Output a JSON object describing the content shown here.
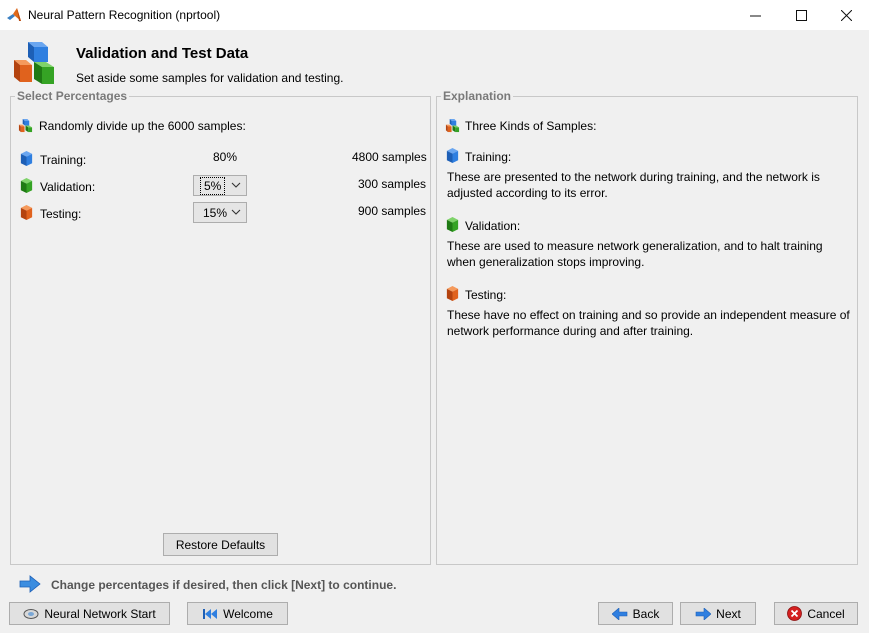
{
  "window": {
    "title": "Neural Pattern Recognition (nprtool)",
    "controls": {
      "minimize": "—",
      "maximize": "☐",
      "close": "✕"
    }
  },
  "header": {
    "title": "Validation and Test Data",
    "subtitle": "Set aside some samples for validation and testing."
  },
  "left_panel": {
    "label": "Select Percentages",
    "intro": "Randomly divide up the 6000 samples:",
    "rows": [
      {
        "label": "Training:",
        "percent": "80%",
        "samples": "4800 samples",
        "icon": "blue-cube-icon"
      },
      {
        "label": "Validation:",
        "percent": "5%",
        "samples": "300 samples",
        "icon": "green-cube-icon"
      },
      {
        "label": "Testing:",
        "percent": "15%",
        "samples": "900 samples",
        "icon": "orange-cube-icon"
      }
    ],
    "restore_label": "Restore Defaults"
  },
  "right_panel": {
    "label": "Explanation",
    "heading": "Three Kinds of Samples:",
    "sections": [
      {
        "title": "Training:",
        "text1": "These are presented to the network during training, and the network is",
        "text2": "adjusted according to its error."
      },
      {
        "title": "Validation:",
        "text1": "These are used to measure network generalization, and to halt training",
        "text2": "when generalization stops improving."
      },
      {
        "title": "Testing:",
        "text1": "These have no effect on training and so provide an independent measure of",
        "text2": "network performance during and after training."
      }
    ]
  },
  "hint": "Change percentages if desired, then click [Next] to continue.",
  "footer": {
    "nn_start": "Neural Network Start",
    "welcome": "Welcome",
    "back": "Back",
    "next": "Next",
    "cancel": "Cancel"
  },
  "colors": {
    "blue": "#1e6fd0",
    "green": "#2e9a1e",
    "orange": "#d9581a",
    "cancel_red": "#d42020"
  }
}
